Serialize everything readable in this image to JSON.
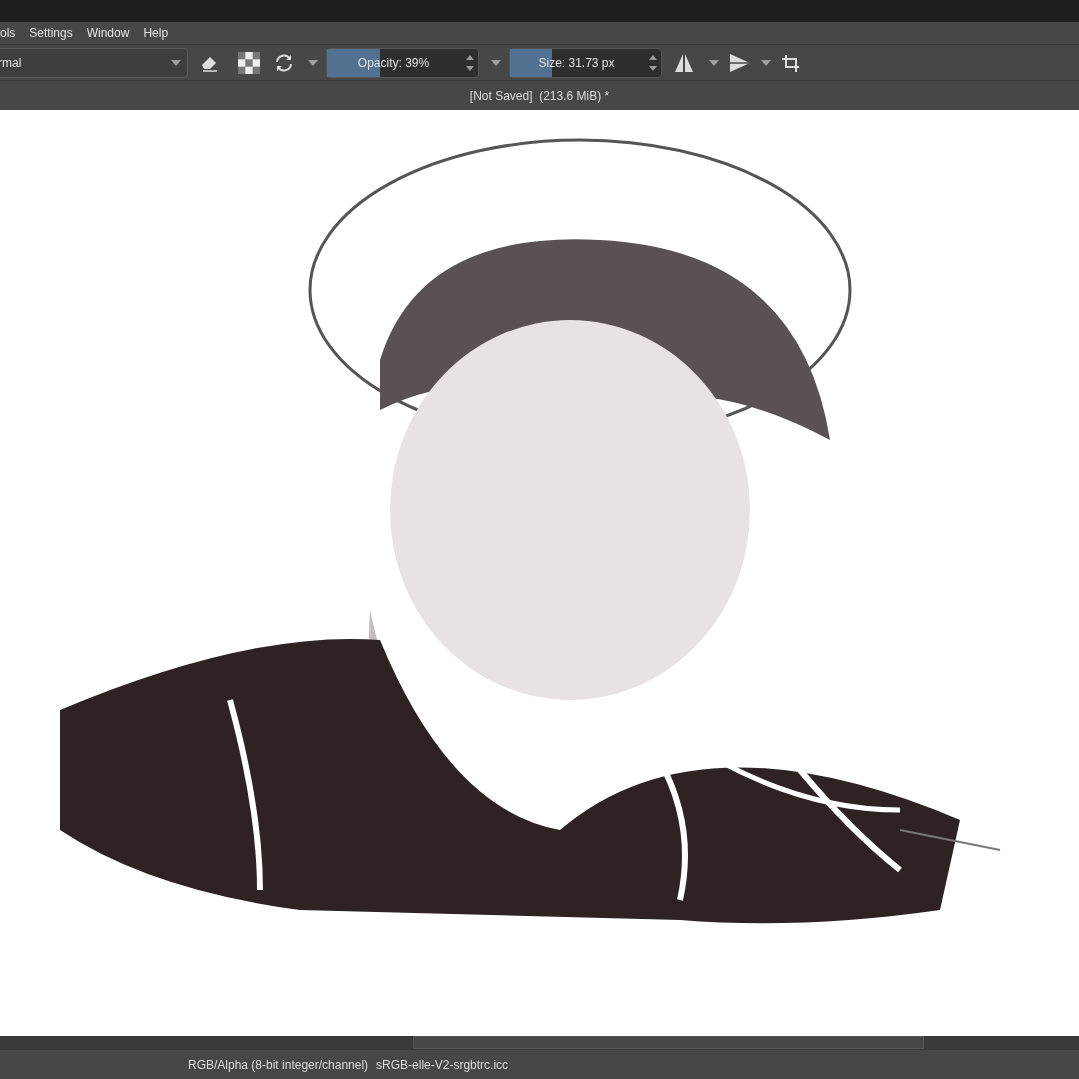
{
  "menu_bar": {
    "items": [
      "ols",
      "Settings",
      "Window",
      "Help"
    ]
  },
  "toolbar": {
    "blend_mode": "rmal",
    "opacity": {
      "label": "Opacity: 39%",
      "level": 0.39
    },
    "size": {
      "label": "Size: 31.73 px",
      "level": 0.31
    }
  },
  "document_title": "[Not Saved]  (213.6 MiB) *",
  "status_bar": {
    "color_space": "RGB/Alpha (8-bit integer/channel)",
    "profile": "sRGB-elle-V2-srgbtrc.icc"
  }
}
